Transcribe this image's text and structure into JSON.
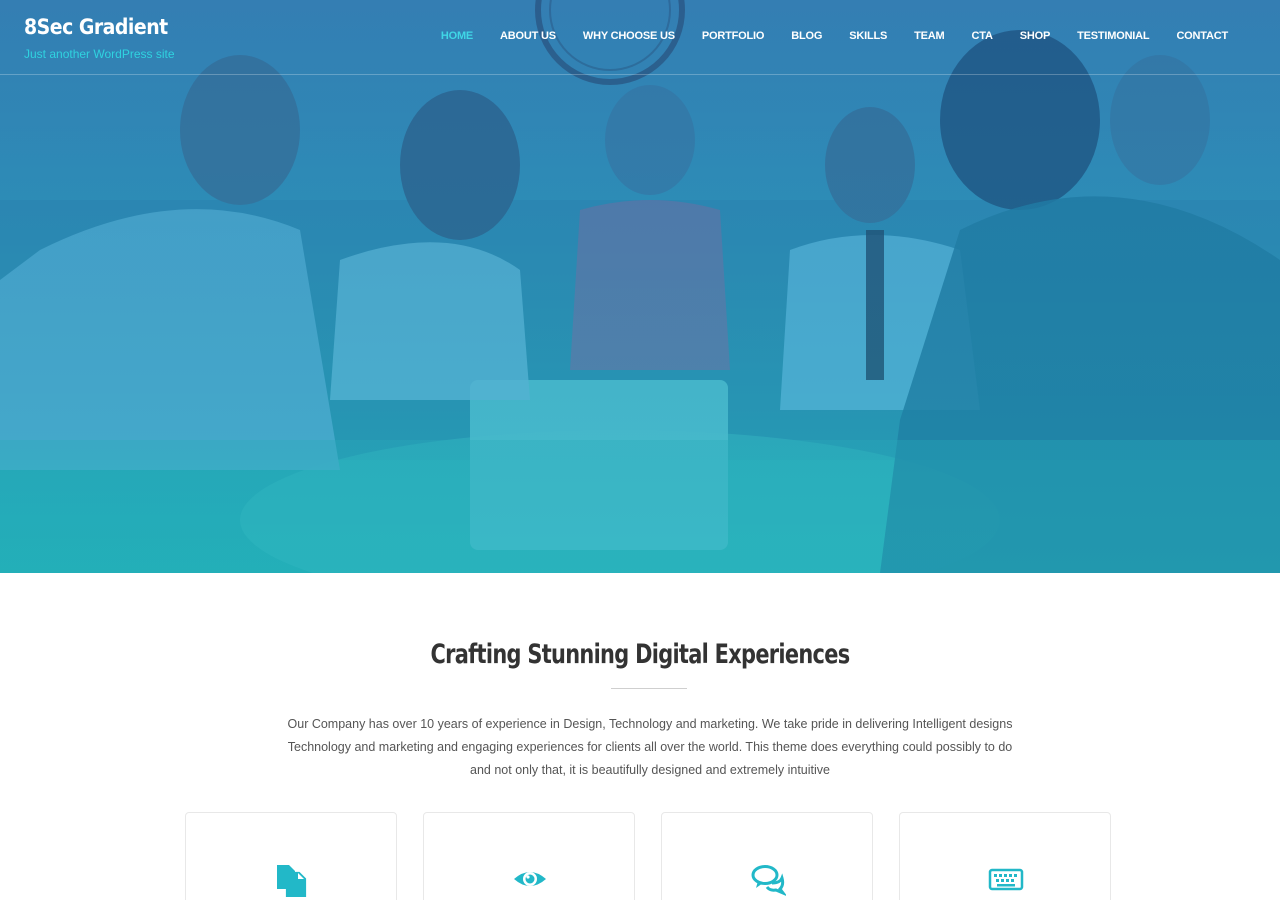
{
  "site": {
    "title": "8Sec Gradient",
    "tagline": "Just another WordPress site"
  },
  "nav": {
    "items": [
      {
        "label": "HOME",
        "active": true
      },
      {
        "label": "ABOUT US",
        "active": false
      },
      {
        "label": "WHY CHOOSE US",
        "active": false
      },
      {
        "label": "PORTFOLIO",
        "active": false
      },
      {
        "label": "BLOG",
        "active": false
      },
      {
        "label": "SKILLS",
        "active": false
      },
      {
        "label": "TEAM",
        "active": false
      },
      {
        "label": "CTA",
        "active": false
      },
      {
        "label": "SHOP",
        "active": false
      },
      {
        "label": "TESTIMONIAL",
        "active": false
      },
      {
        "label": "CONTACT",
        "active": false
      }
    ]
  },
  "intro": {
    "heading": "Crafting Stunning Digital Experiences",
    "text_lines": [
      "Our Company has over 10 years of experience in Design, Technology and marketing. We take pride in delivering Intelligent designs",
      "Technology and marketing and engaging experiences for clients all over the world. This theme does everything could possibly to do",
      "and not only that, it is beautifully designed and extremely intuitive"
    ]
  },
  "features": [
    {
      "icon": "documents-icon"
    },
    {
      "icon": "eye-icon"
    },
    {
      "icon": "chat-icon"
    },
    {
      "icon": "keyboard-icon"
    }
  ],
  "colors": {
    "accent": "#22b8c8",
    "nav_active": "#3fd6e6",
    "tagline": "#2fd3e0"
  }
}
